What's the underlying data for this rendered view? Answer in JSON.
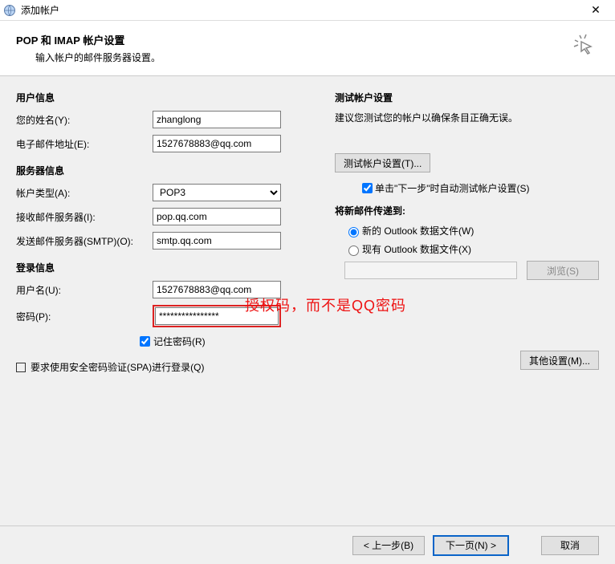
{
  "window": {
    "title": "添加帐户",
    "close": "✕"
  },
  "header": {
    "title": "POP 和 IMAP 帐户设置",
    "subtitle": "输入帐户的邮件服务器设置。"
  },
  "left": {
    "user_info_title": "用户信息",
    "name_label": "您的姓名(Y):",
    "name_value": "zhanglong",
    "email_label": "电子邮件地址(E):",
    "email_value": "1527678883@qq.com",
    "server_info_title": "服务器信息",
    "acct_type_label": "帐户类型(A):",
    "acct_type_value": "POP3",
    "incoming_label": "接收邮件服务器(I):",
    "incoming_value": "pop.qq.com",
    "outgoing_label": "发送邮件服务器(SMTP)(O):",
    "outgoing_value": "smtp.qq.com",
    "login_info_title": "登录信息",
    "username_label": "用户名(U):",
    "username_value": "1527678883@qq.com",
    "password_label": "密码(P):",
    "password_value": "****************",
    "remember_pw_label": "记住密码(R)",
    "spa_label": "要求使用安全密码验证(SPA)进行登录(Q)"
  },
  "right": {
    "test_title": "测试帐户设置",
    "test_desc": "建议您测试您的帐户以确保条目正确无误。",
    "test_btn": "测试帐户设置(T)...",
    "auto_test_label": "单击\"下一步\"时自动测试帐户设置(S)",
    "deliver_title": "将新邮件传递到:",
    "radio_new": "新的 Outlook 数据文件(W)",
    "radio_existing": "现有 Outlook 数据文件(X)",
    "browse_btn": "浏览(S)",
    "other_settings_btn": "其他设置(M)..."
  },
  "footer": {
    "back": "< 上一步(B)",
    "next": "下一页(N) >",
    "cancel": "取消"
  },
  "annotation": "授权码，而不是QQ密码"
}
